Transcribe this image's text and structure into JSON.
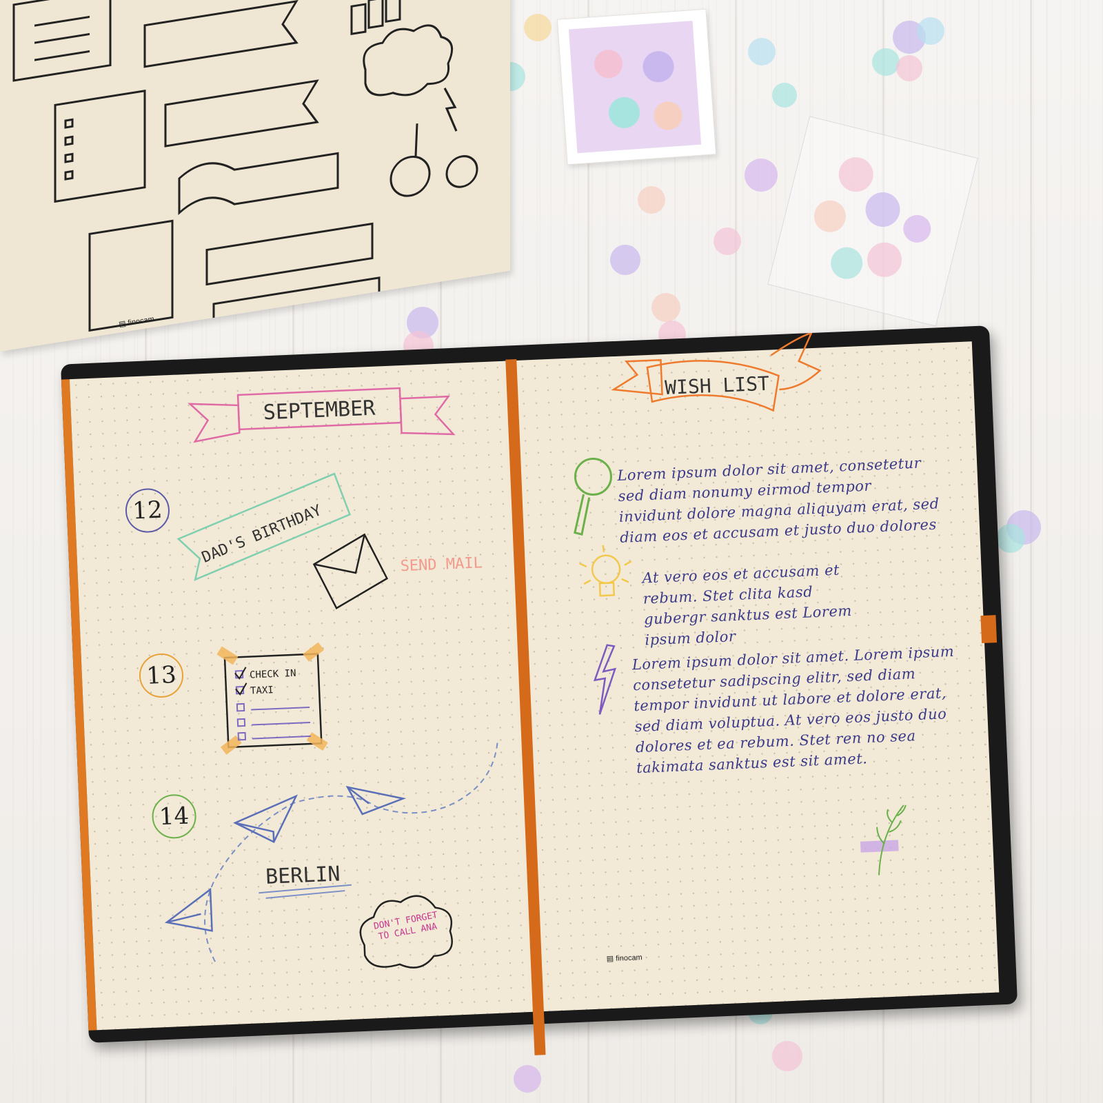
{
  "scene": {
    "background_color": "#f1efec",
    "sticker_sheet_brand": "finocam",
    "notebook_brand": "finocam",
    "accent_color": "#d66a1b"
  },
  "left_page": {
    "month_banner": "SEPTEMBER",
    "days": [
      {
        "number": "12",
        "ring_color": "#5b5aa8"
      },
      {
        "number": "13",
        "ring_color": "#e8a23a"
      },
      {
        "number": "14",
        "ring_color": "#6bb04a"
      }
    ],
    "birthday_tag": "DAD'S BIRTHDAY",
    "mail_label": "SEND MAIL",
    "checklist_items": [
      "CHECK IN",
      "TAXI"
    ],
    "city_label": "BERLIN",
    "speech_bubble": "DON'T FORGET TO CALL ANA"
  },
  "right_page": {
    "title_banner": "WISH LIST",
    "paragraph_1": "Lorem ipsum dolor sit amet, consetetur sed diam nonumy eirmod tempor invidunt dolore magna aliquyam erat, sed diam eos et accusam et justo duo dolores",
    "paragraph_2": "At vero eos et accusam et rebum. Stet clita kasd gubergr sanktus est Lorem ipsum dolor",
    "paragraph_3": "Lorem ipsum dolor sit amet. Lorem ipsum consetetur sadipscing elitr, sed diam tempor invidunt ut labore et dolore erat, sed diam voluptua. At vero eos justo duo dolores et ea rebum. Stet ren no sea takimata sanktus est sit amet."
  }
}
